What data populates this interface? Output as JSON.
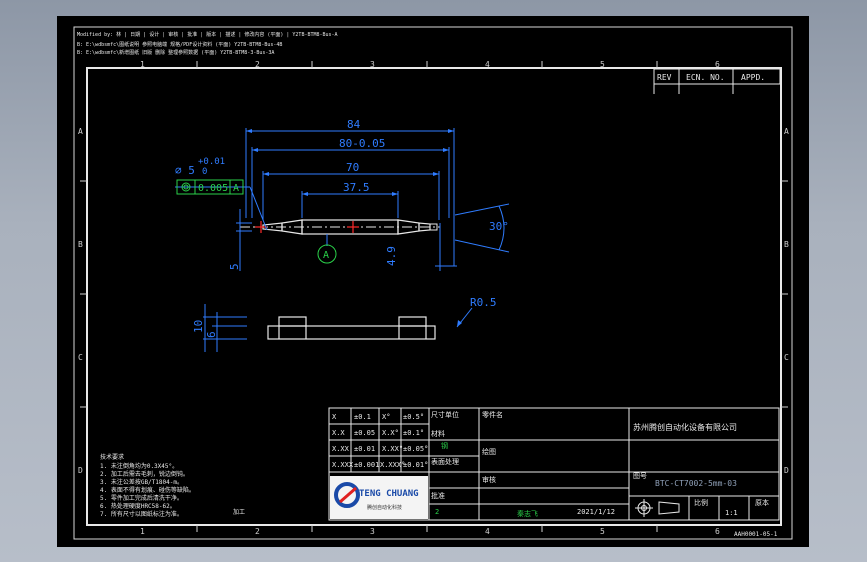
{
  "header_notes": [
    "Modified by: 林 | 日期 | 设计 | 审核 | 批准 | 版本 | 描述 | 修改内容 (平面) | Y2TB-BTM8-Bus-A",
    "B: E:\\wdbsmfc\\图纸说明 参照电脑端 规格/PDF设计资料 (平面) Y2TB-BTM8-Bus-4B",
    "B: E:\\wdbsmfc\\新增图纸 旧版 删除 整理参照数据 (平面) Y2TB-BTM8-3-Bus-3A"
  ],
  "zones": {
    "cols": [
      "1",
      "2",
      "3",
      "4",
      "5",
      "6"
    ],
    "rows": [
      "A",
      "B",
      "C",
      "D"
    ]
  },
  "revision_block": {
    "rev": "REV",
    "ecn": "ECN. NO.",
    "appd": "APPD."
  },
  "dimensions": {
    "d84": "84",
    "d80": "80-0.05",
    "d70": "70",
    "d375": "37.5",
    "diameter": "⌀ 5",
    "tol_plus": "+0.01",
    "tol_zero": "0",
    "fcf_value": "0.005",
    "fcf_datum": "A",
    "angle": "30°",
    "d49": "4.9",
    "d5": "5",
    "datum": "A",
    "radius": "R0.5",
    "d10": "10",
    "d6": "6"
  },
  "tolerance_table": [
    [
      "X",
      "±0.1",
      "X°",
      "±0.5°"
    ],
    [
      "X.X",
      "±0.05",
      "X.X°",
      "±0.1°"
    ],
    [
      "X.XX",
      "±0.01",
      "X.XX°",
      "±0.05°"
    ],
    [
      "X.XXX",
      "±0.001",
      "X.XXX°",
      "±0.01°"
    ]
  ],
  "title_block": {
    "size_label": "尺寸单位",
    "material_label": "材料",
    "material_value": "钢",
    "treatment_label": "表面处理",
    "drawn_label": "绘图",
    "checked_label": "审核",
    "approved_label": "批准",
    "scale_label": "比例",
    "sheet_label": "原本",
    "qty_value": "2",
    "drafter": "秦志飞",
    "date": "2021/1/12",
    "company": "苏州腾创自动化设备有限公司",
    "drawing_no_label": "图号",
    "drawing_no": "BTC-CT7002-5mm-03",
    "part_label": "零件名",
    "scale_value": "1:1",
    "brand_name": "TENG CHUANG",
    "brand_sub": "腾创自动化科技",
    "footer_code": "AAH0001-05-1"
  },
  "notes": {
    "heading": "技术要求",
    "lines": [
      "1. 未注倒角均为0.3X45°。",
      "2. 加工后需去毛刺，锐边倒钝。",
      "3. 未注公差按GB/T1804-m。",
      "4. 表面不得有划痕、碰伤等缺陷。",
      "5. 零件加工完成后清洗干净。",
      "6. 热处理硬度HRC58-62。",
      "7. 所有尺寸以图纸标注为准。"
    ],
    "tag": "加工"
  }
}
